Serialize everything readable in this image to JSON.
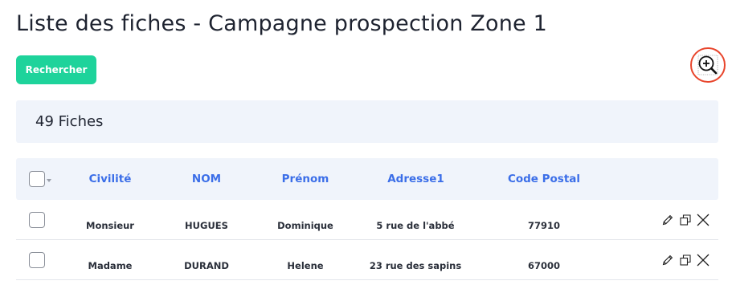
{
  "page": {
    "title": "Liste des fiches - Campagne prospection Zone 1"
  },
  "toolbar": {
    "search_label": "Rechercher",
    "zoom_icon": "zoom-in-icon"
  },
  "summary": {
    "count_label": "49 Fiches"
  },
  "table": {
    "columns": [
      "Civilité",
      "NOM",
      "Prénom",
      "Adresse1",
      "Code Postal"
    ],
    "rows": [
      {
        "civilite": "Monsieur",
        "nom": "HUGUES",
        "prenom": "Dominique",
        "adresse1": "5 rue de l'abbé",
        "code_postal": "77910"
      },
      {
        "civilite": "Madame",
        "nom": "DURAND",
        "prenom": "Helene",
        "adresse1": "23 rue des sapins",
        "code_postal": "67000"
      }
    ]
  },
  "colors": {
    "accent_button": "#1ed39b",
    "header_text": "#3b6ee8",
    "panel_bg": "#f0f4fb",
    "zoom_ring": "#e8452c"
  }
}
